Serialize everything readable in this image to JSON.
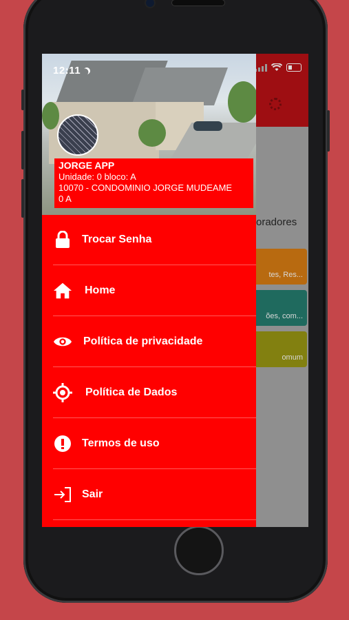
{
  "status_bar": {
    "time": "12:11"
  },
  "drawer": {
    "user": {
      "name": "JORGE APP",
      "unit_line": "Unidade: 0 bloco: A",
      "condo_line": "10070 - CONDOMINIO JORGE MUDEAME",
      "extra_line": "0 A"
    },
    "menu": [
      {
        "label": "Trocar Senha",
        "icon": "lock-icon"
      },
      {
        "label": "Home",
        "icon": "home-icon"
      },
      {
        "label": "Política de privacidade",
        "icon": "eye-icon"
      },
      {
        "label": "Política de Dados",
        "icon": "crosshair-icon"
      },
      {
        "label": "Termos de uso",
        "icon": "exclamation-circle-icon"
      },
      {
        "label": "Sair",
        "icon": "sign-out-icon"
      }
    ]
  },
  "background_app": {
    "section_title_fragment": "oradores",
    "cards": [
      {
        "text": "tes, Res...",
        "color": "#b86a10"
      },
      {
        "text": "ões, com...",
        "color": "#1f6a5e"
      },
      {
        "text": "omum",
        "color": "#828010"
      }
    ]
  },
  "colors": {
    "drawer": "#ff0000",
    "page_background": "#c5464a"
  }
}
